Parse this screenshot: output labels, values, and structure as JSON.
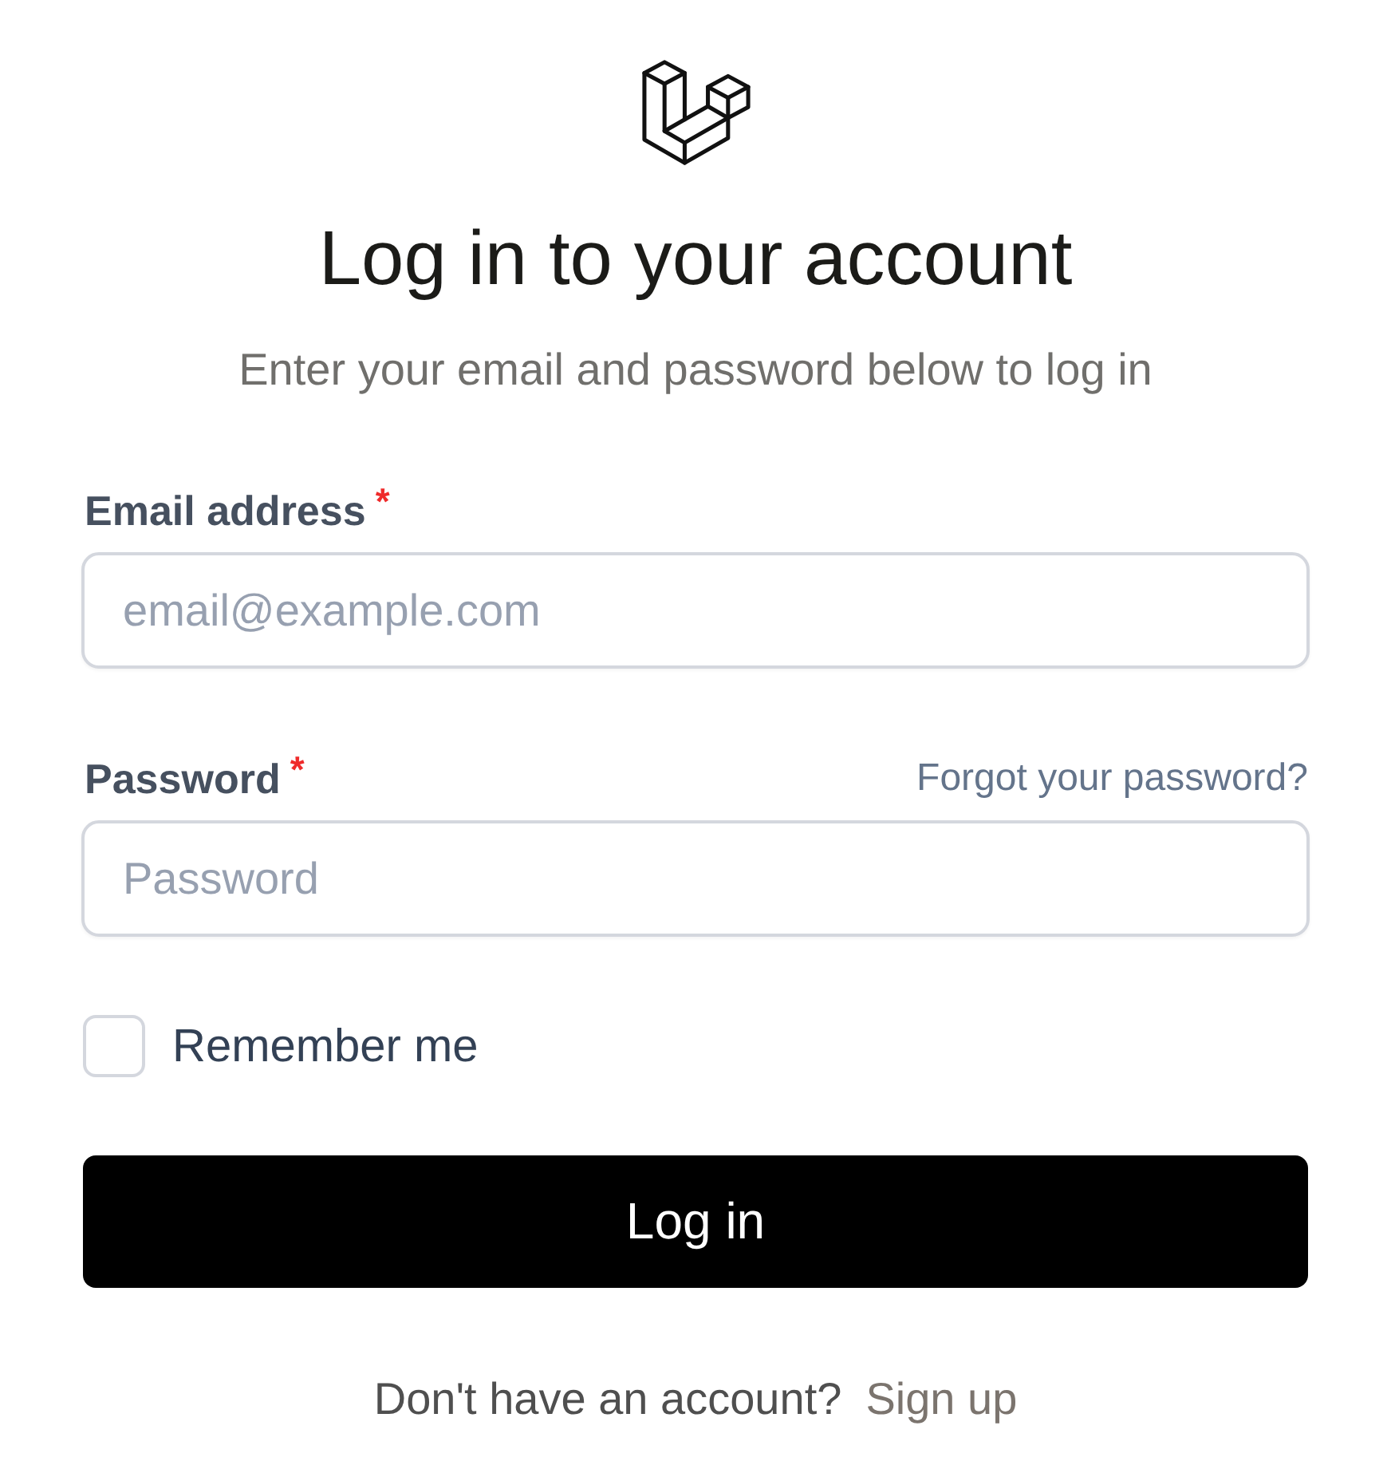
{
  "heading": {
    "title": "Log in to your account",
    "subtitle": "Enter your email and password below to log in"
  },
  "fields": [
    {
      "label": "Email address",
      "required_mark": "*",
      "placeholder": "email@example.com"
    },
    {
      "label": "Password",
      "required_mark": "*",
      "placeholder": "Password",
      "link": "Forgot your password?"
    }
  ],
  "remember": {
    "label": "Remember me",
    "checked": false
  },
  "submit": "Log in",
  "footer": {
    "text": "Don't have an account?",
    "link": "Sign up"
  }
}
